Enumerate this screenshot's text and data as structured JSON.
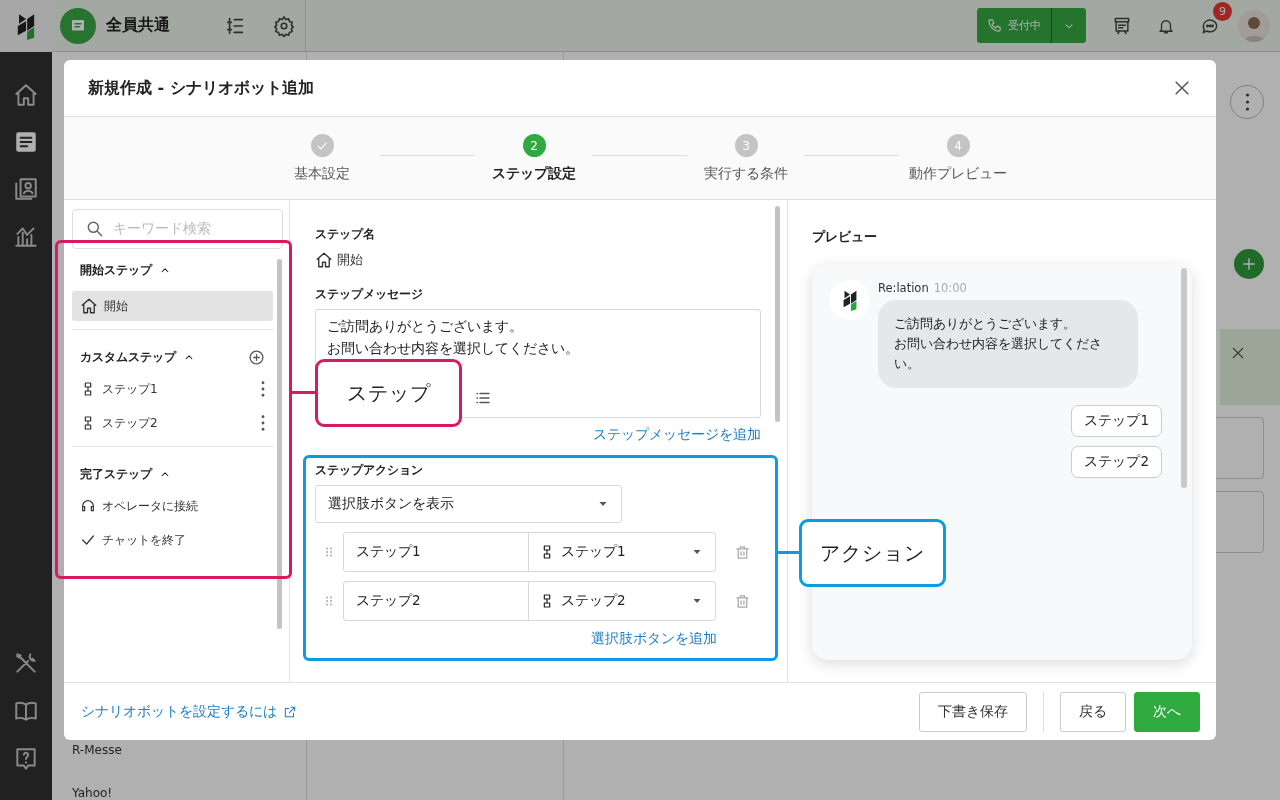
{
  "topbar": {
    "inbox_name": "全員共通",
    "status_button": "受付中",
    "chat_badge": "9"
  },
  "nav_rail": [
    {
      "kind": "home",
      "selected": false
    },
    {
      "kind": "inbox",
      "selected": true
    },
    {
      "kind": "contacts",
      "selected": false
    },
    {
      "kind": "analytics",
      "selected": false
    }
  ],
  "nav_rail_bottom": [
    {
      "kind": "tools"
    },
    {
      "kind": "book"
    },
    {
      "kind": "help"
    }
  ],
  "background_list": [
    "R-Messe",
    "Yahoo!"
  ],
  "modal": {
    "title": "新規作成 - シナリオボット追加",
    "steps": [
      {
        "label": "基本設定",
        "done": true,
        "selected": false
      },
      {
        "number": "2",
        "label": "ステップ設定",
        "done": false,
        "selected": true
      },
      {
        "number": "3",
        "label": "実行する条件",
        "done": false,
        "selected": false
      },
      {
        "number": "4",
        "label": "動作プレビュー",
        "done": false,
        "selected": false
      }
    ],
    "sidebar": {
      "search_placeholder": "キーワード検索",
      "sections": [
        {
          "title": "開始ステップ",
          "expanded": true,
          "addable": false,
          "items": [
            {
              "label": "開始",
              "kind": "start",
              "selected": true
            }
          ]
        },
        {
          "title": "カスタムステップ",
          "expanded": true,
          "addable": true,
          "items": [
            {
              "label": "ステップ1",
              "kind": "custom",
              "selected": false
            },
            {
              "label": "ステップ2",
              "kind": "custom",
              "selected": false
            }
          ]
        },
        {
          "title": "完了ステップ",
          "expanded": true,
          "addable": false,
          "items": [
            {
              "label": "オペレータに接続",
              "kind": "operator",
              "selected": false
            },
            {
              "label": "チャットを終了",
              "kind": "end",
              "selected": false
            }
          ]
        }
      ]
    },
    "editor": {
      "name_label": "ステップ名",
      "name_value": "開始",
      "message_label": "ステップメッセージ",
      "message_lines": [
        "ご訪問ありがとうございます。",
        "お問い合わせ内容を選択してください。"
      ],
      "add_message_link": "ステップメッセージを追加",
      "action_label": "ステップアクション",
      "action_type": "選択肢ボタンを表示",
      "choices": [
        {
          "text": "ステップ1",
          "target": "ステップ1"
        },
        {
          "text": "ステップ2",
          "target": "ステップ2"
        }
      ],
      "add_choice_link": "選択肢ボタンを追加"
    },
    "preview": {
      "title": "プレビュー",
      "sender": "Re:lation",
      "time": "10:00",
      "message_lines": [
        "ご訪問ありがとうございます。",
        "お問い合わせ内容を選択してください。"
      ],
      "choices": [
        "ステップ1",
        "ステップ2"
      ]
    },
    "footer": {
      "help_link": "シナリオボットを設定するには",
      "buttons": [
        {
          "label": "下書き保存",
          "kind": "secondary"
        },
        {
          "label": "戻る",
          "kind": "secondary"
        },
        {
          "label": "次へ",
          "kind": "primary"
        }
      ]
    }
  },
  "annotations": [
    {
      "label": "ステップ",
      "color": "#d81b60"
    },
    {
      "label": "アクション",
      "color": "#0a9be0"
    }
  ]
}
